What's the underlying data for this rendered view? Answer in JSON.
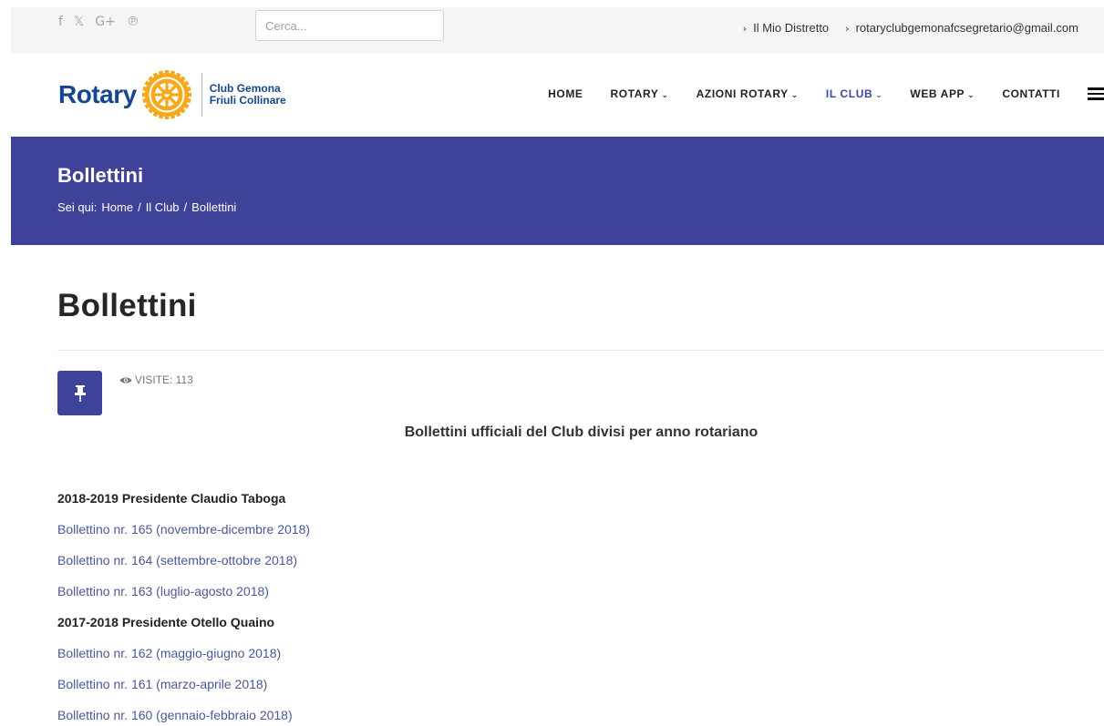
{
  "topbar": {
    "social": [
      "f",
      "𝕏",
      "G+",
      "℗"
    ],
    "search_placeholder": "Cerca...",
    "links": [
      "Il Mio Distretto",
      "rotaryclubgemonafcsegretario@gmail.com"
    ]
  },
  "header": {
    "logo_word": "Rotary",
    "club_line1": "Club Gemona",
    "club_line2": "Friuli Collinare",
    "nav": [
      {
        "label": "HOME",
        "has_menu": false
      },
      {
        "label": "ROTARY",
        "has_menu": true
      },
      {
        "label": "AZIONI ROTARY",
        "has_menu": true
      },
      {
        "label": "IL CLUB",
        "has_menu": true
      },
      {
        "label": "WEB APP",
        "has_menu": true
      },
      {
        "label": "CONTATTI",
        "has_menu": false
      }
    ]
  },
  "banner": {
    "title": "Bollettini",
    "crumb_prefix": "Sei qui:",
    "crumbs": [
      "Home",
      "Il Club",
      "Bollettini"
    ]
  },
  "article": {
    "title": "Bollettini",
    "visits": "VISITE: 113",
    "intro": "Bollettini ufficiali del Club divisi per anno rotariano",
    "entries": [
      {
        "kind": "year",
        "text": "2018-2019 Presidente Claudio Taboga"
      },
      {
        "kind": "link",
        "text": "Bollettino nr. 165 (novembre-dicembre 2018)"
      },
      {
        "kind": "link",
        "text": "Bollettino nr. 164 (settembre-ottobre 2018)"
      },
      {
        "kind": "link",
        "text": "Bollettino nr. 163 (luglio-agosto 2018)"
      },
      {
        "kind": "year",
        "text": "2017-2018 Presidente Otello Quaino"
      },
      {
        "kind": "link",
        "text": "Bollettino nr. 162 (maggio-giugno 2018)"
      },
      {
        "kind": "link",
        "text": "Bollettino nr. 161 (marzo-aprile 2018)"
      },
      {
        "kind": "link",
        "text": "Bollettino nr. 160 (gennaio-febbraio 2018)"
      }
    ]
  },
  "colors": {
    "brand_blue": "#17458f",
    "brand_gold": "#f7a81b",
    "banner": "#3e4399",
    "link": "#4b5899"
  },
  "icons": {
    "social": [
      "facebook-icon",
      "twitter-icon",
      "google-plus-icon",
      "pinterest-icon"
    ],
    "pin": "pushpin-icon",
    "visits": "eye-icon",
    "menu": "hamburger-menu-icon"
  }
}
